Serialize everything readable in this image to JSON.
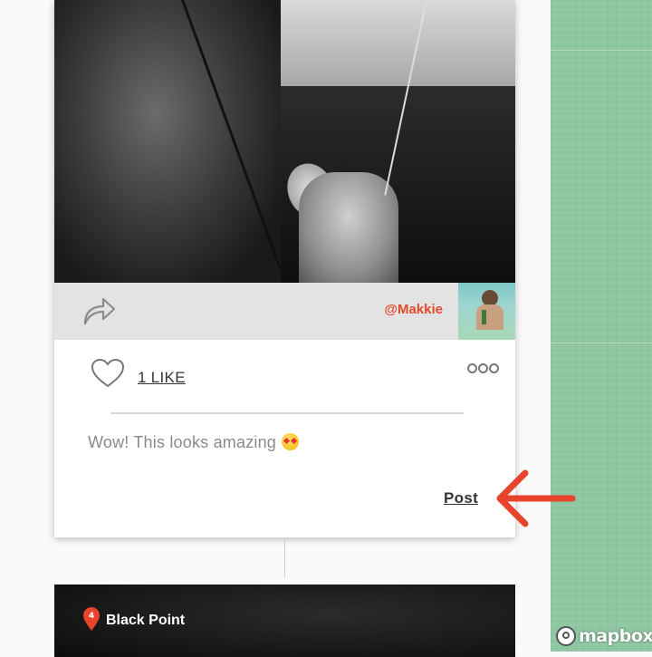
{
  "post": {
    "handle": "@Makkie",
    "likes_label": "1 LIKE",
    "comment_text": "Wow! This looks amazing",
    "comment_emoji": "star-struck-emoji",
    "post_button": "Post"
  },
  "next_location": {
    "number": "4",
    "name": "Black Point"
  },
  "map": {
    "attribution": "mapbox"
  },
  "colors": {
    "accent": "#e24a2a",
    "map_green": "#8dc6a1",
    "info_bar": "#e3e3e3"
  },
  "icons": [
    "share-arrow-icon",
    "heart-icon",
    "more-options-icon",
    "location-pin-icon",
    "annotation-arrow",
    "mapbox-logo"
  ]
}
